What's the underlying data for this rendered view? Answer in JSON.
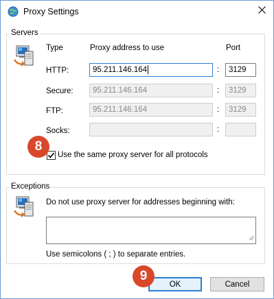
{
  "window": {
    "title": "Proxy Settings",
    "icon": "globe-network-icon",
    "close_icon": "close-icon"
  },
  "servers": {
    "group_label": "Servers",
    "icon": "network-computer-icon",
    "col_type": "Type",
    "col_address": "Proxy address to use",
    "col_port": "Port",
    "rows": [
      {
        "type": "HTTP:",
        "address": "95.211.146.164",
        "port": "3129",
        "enabled": true
      },
      {
        "type": "Secure:",
        "address": "95.211.146.164",
        "port": "3129",
        "enabled": false
      },
      {
        "type": "FTP:",
        "address": "95.211.146.164",
        "port": "3129",
        "enabled": false
      },
      {
        "type": "Socks:",
        "address": "",
        "port": "",
        "enabled": false
      }
    ],
    "colon": ":",
    "same_proxy_label": "Use the same proxy server for all protocols",
    "same_proxy_checked": true
  },
  "exceptions": {
    "group_label": "Exceptions",
    "icon": "network-computer-icon",
    "description": "Do not use proxy server for addresses beginning with:",
    "value": "",
    "hint": "Use semicolons ( ; ) to separate entries."
  },
  "buttons": {
    "ok": "OK",
    "cancel": "Cancel"
  },
  "badges": {
    "step8": "8",
    "step9": "9"
  },
  "colors": {
    "badge": "#d9482b",
    "focus": "#2a7fd4"
  }
}
